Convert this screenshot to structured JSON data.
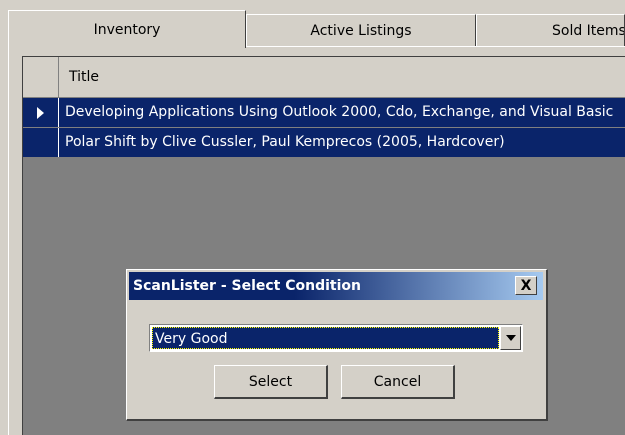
{
  "tabs": [
    {
      "label": "Inventory",
      "active": true
    },
    {
      "label": "Active Listings",
      "active": false
    },
    {
      "label": "Sold Items",
      "active": false
    }
  ],
  "grid": {
    "columns": [
      "Title"
    ],
    "rows": [
      {
        "title": "Developing Applications Using Outlook 2000, Cdo, Exchange, and Visual Basic",
        "current": true
      },
      {
        "title": "Polar Shift by Clive Cussler, Paul Kemprecos (2005, Hardcover)",
        "current": false
      }
    ]
  },
  "dialog": {
    "title": "ScanLister - Select Condition",
    "close_label": "X",
    "condition_value": "Very Good",
    "select_label": "Select",
    "cancel_label": "Cancel"
  },
  "colors": {
    "selection": "#0a246a",
    "face": "#d4d0c8",
    "grid_bg": "#808080"
  }
}
